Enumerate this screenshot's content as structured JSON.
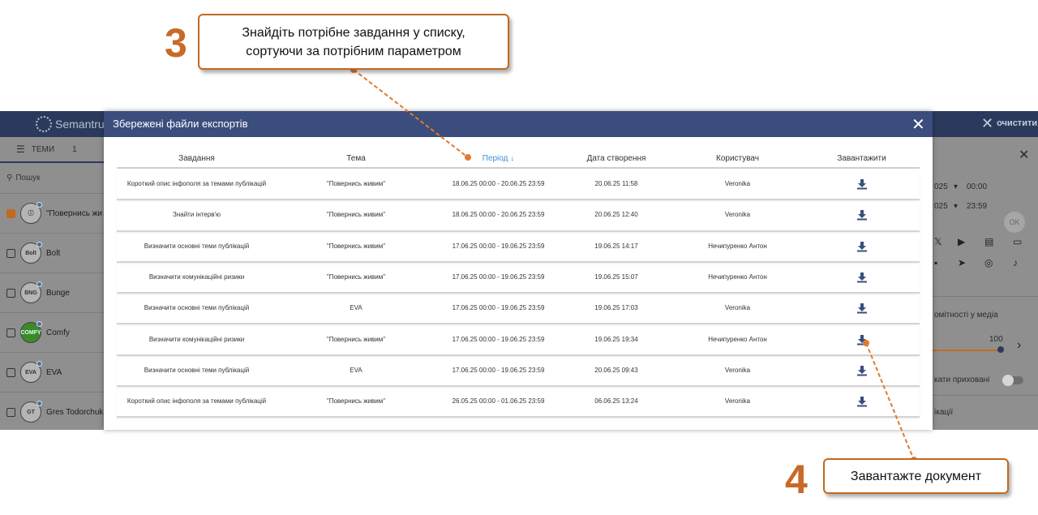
{
  "app": {
    "brand": "Semantrum",
    "clear_label": "очистити",
    "tabs_label": "ТЕМИ",
    "tabs_count": "1",
    "search_placeholder": "Пошук",
    "topics": [
      {
        "name": "\"Повернись жи",
        "avatar": "ⓘ",
        "checked": true
      },
      {
        "name": "Bolt",
        "avatar": "Bolt",
        "checked": false
      },
      {
        "name": "Bunge",
        "avatar": "BNG",
        "checked": false
      },
      {
        "name": "Comfy",
        "avatar": "COMFY",
        "checked": false
      },
      {
        "name": "EVA",
        "avatar": "EVA",
        "checked": false
      },
      {
        "name": "Gres Todorchuk",
        "avatar": "GT",
        "checked": false
      }
    ],
    "right_panel": {
      "year_1": "025",
      "time_1": "00:00",
      "year_2": "025",
      "time_2": "23:59",
      "ok_label": "OK",
      "media_label": "омітності у медіа",
      "slider_value": "100",
      "hidden_label": "кати приховані",
      "bottom_label": "ікації"
    }
  },
  "modal": {
    "title": "Збережені файли експортів",
    "columns": {
      "task": "Завдання",
      "topic": "Тема",
      "period": "Період",
      "period_sort": "↓",
      "created": "Дата створення",
      "user": "Користувач",
      "download": "Завантажити"
    },
    "rows": [
      {
        "task": "Короткий опис інфополя за темами публікацій",
        "topic": "\"Повернись живим\"",
        "period": "18.06.25 00:00 - 20.06.25 23:59",
        "created": "20.06.25 11:58",
        "user": "Veronika"
      },
      {
        "task": "Знайти інтерв'ю",
        "topic": "\"Повернись живим\"",
        "period": "18.06.25 00:00 - 20.06.25 23:59",
        "created": "20.06.25 12:40",
        "user": "Veronika"
      },
      {
        "task": "Визначити основні теми публікацій",
        "topic": "\"Повернись живим\"",
        "period": "17.06.25 00:00 - 19.06.25 23:59",
        "created": "19.06.25 14:17",
        "user": "Нечипуренко Антон"
      },
      {
        "task": "Визначити комунікаційні ризики",
        "topic": "\"Повернись живим\"",
        "period": "17.06.25 00:00 - 19.06.25 23:59",
        "created": "19.06.25 15:07",
        "user": "Нечипуренко Антон"
      },
      {
        "task": "Визначити основні теми публікацій",
        "topic": "EVA",
        "period": "17.06.25 00:00 - 19.06.25 23:59",
        "created": "19.06.25 17:03",
        "user": "Veronika"
      },
      {
        "task": "Визначити комунікаційні ризики",
        "topic": "\"Повернись живим\"",
        "period": "17.06.25 00:00 - 19.06.25 23:59",
        "created": "19.06.25 19:34",
        "user": "Нечипуренко Антон"
      },
      {
        "task": "Визначити основні теми публікацій",
        "topic": "EVA",
        "period": "17.06.25 00:00 - 19.06.25 23:59",
        "created": "20.06.25 09:43",
        "user": "Veronika"
      },
      {
        "task": "Короткий опис інфополя за темами публікацій",
        "topic": "\"Повернись живим\"",
        "period": "26.05.25 00:00 - 01.06.25 23:59",
        "created": "06.06.25 13:24",
        "user": "Veronika"
      }
    ]
  },
  "callouts": {
    "step3_number": "3",
    "step3_text_line1": "Знайдіть потрібне завдання у списку,",
    "step3_text_line2": "сортуючи за потрібним параметром",
    "step4_number": "4",
    "step4_text": "Завантажте документ",
    "color": "#c06a20"
  }
}
